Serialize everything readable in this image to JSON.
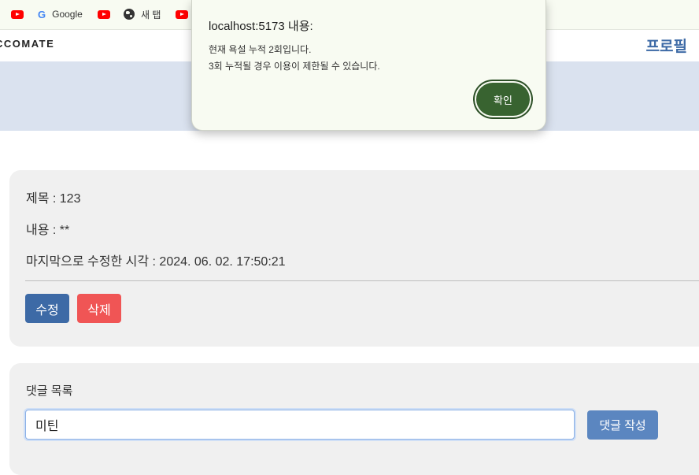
{
  "bookmarks": [
    {
      "icon": "youtube-icon",
      "label": ""
    },
    {
      "icon": "google-icon",
      "label": "Google"
    },
    {
      "icon": "youtube-icon",
      "label": ""
    },
    {
      "icon": "globe-icon",
      "label": "새 탭"
    },
    {
      "icon": "youtube-icon",
      "label": ""
    }
  ],
  "navbar": {
    "brand": "CCOMATE",
    "profile": "프로필"
  },
  "post": {
    "title": "제목 : 123",
    "content": "내용 : **",
    "modified": "마지막으로 수정한 시각 : 2024. 06. 02. 17:50:21",
    "edit_label": "수정",
    "delete_label": "삭제"
  },
  "comments": {
    "heading": "댓글 목록",
    "input_value": "미틴",
    "submit_label": "댓글 작성"
  },
  "dialog": {
    "title": "localhost:5173 내용:",
    "message_line1": "현재 욕설 누적 2회입니다.",
    "message_line2": "3회 누적될 경우 이용이 제한될 수 있습니다.",
    "confirm_label": "확인"
  },
  "colors": {
    "primary": "#3d6aa6",
    "danger": "#f05555",
    "dialog_button": "#386330",
    "banner": "#dae2ef"
  }
}
